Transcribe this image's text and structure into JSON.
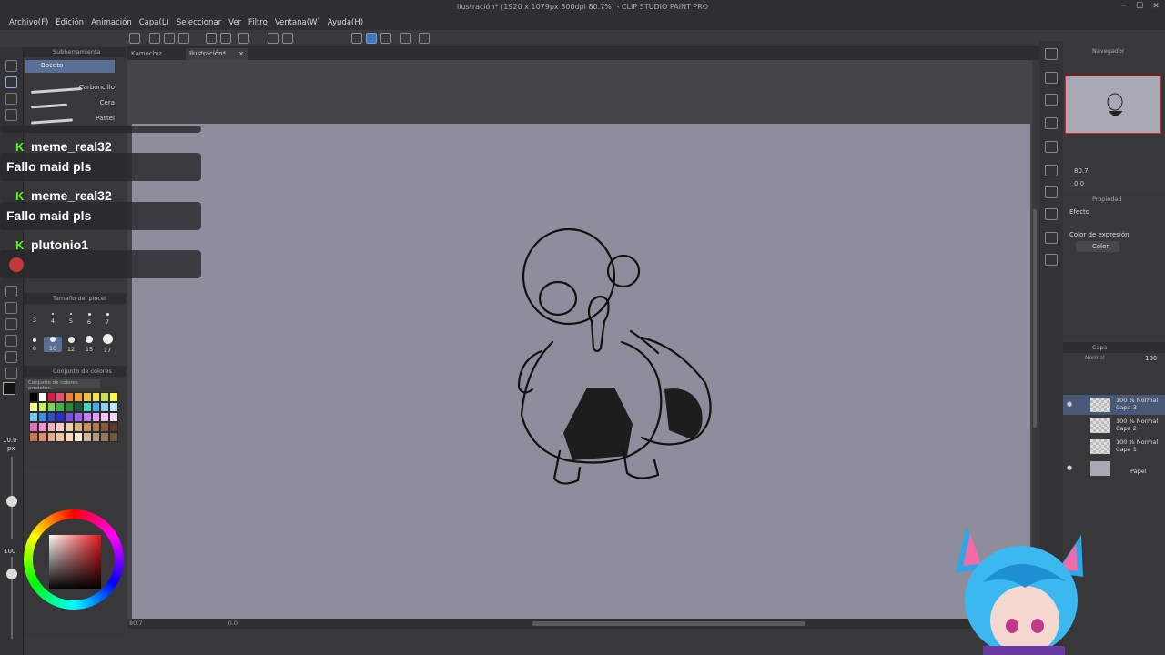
{
  "window": {
    "title": "Ilustración* (1920 x 1079px 300dpi 80.7%) - CLIP STUDIO PAINT PRO",
    "min": "─",
    "max": "☐",
    "close": "✕"
  },
  "menu": [
    "Archivo(F)",
    "Edición",
    "Animación",
    "Capa(L)",
    "Seleccionar",
    "Ver",
    "Filtro",
    "Ventana(W)",
    "Ayuda(H)"
  ],
  "tabs": [
    {
      "label": "Kamochiz"
    },
    {
      "label": "Ilustración*",
      "close": "×"
    }
  ],
  "subtool": {
    "header": "Subherramienta",
    "selected": "Boceto",
    "brushes": [
      "Carboncillo",
      "Cera",
      "Pastel"
    ]
  },
  "brush_size": {
    "header": "Tamaño del pincel",
    "row1": [
      "3",
      "4",
      "5",
      "6",
      "7"
    ],
    "row2": [
      "8",
      "10",
      "12",
      "15",
      "17"
    ],
    "selected": "10"
  },
  "left_size": {
    "value": "10.0",
    "unit": "px",
    "opacity": "100"
  },
  "color_set": {
    "header": "Conjunto de colores",
    "selector": "Conjunto de colores predeter...",
    "colors": [
      "#000000",
      "#ffffff",
      "#e8143c",
      "#ef4b79",
      "#f07d3b",
      "#f0a030",
      "#f0c040",
      "#f5e04a",
      "#c8e04a",
      "#fbfb40",
      "#f8f888",
      "#c8f05a",
      "#7ad25a",
      "#3cb44a",
      "#2a8a3a",
      "#1a5a3a",
      "#40d8c0",
      "#40b0f0",
      "#8ad0f0",
      "#c0e8f8",
      "#6ec8f0",
      "#3a90e8",
      "#2850d0",
      "#2a2ad8",
      "#7a50e0",
      "#a060f0",
      "#c080f8",
      "#e0a0f8",
      "#f0c0f0",
      "#f8d8f0",
      "#e070c0",
      "#f090d0",
      "#f0b0c0",
      "#f8c8c8",
      "#e8d0b0",
      "#d8b080",
      "#c09060",
      "#a87848",
      "#8a5a38",
      "#5a3a28",
      "#c87850",
      "#d89070",
      "#e8a888",
      "#f0c0a0",
      "#f8d8c0",
      "#fae8d8",
      "#d0b8a0",
      "#b09880",
      "#907860",
      "#705840"
    ]
  },
  "navigator": {
    "header": "Navegador",
    "zoom": "80.7",
    "rotation": "0.0"
  },
  "properties": {
    "header": "Propiedad",
    "effect": "Efecto",
    "expression_label": "Color de expresión",
    "expression_value": "Color"
  },
  "layers": {
    "header": "Capa",
    "blend": "Normal",
    "opacity": "100",
    "items": [
      {
        "opacity": "100 % Normal",
        "name": "Capa 3",
        "selected": true
      },
      {
        "opacity": "100 % Normal",
        "name": "Capa 2"
      },
      {
        "opacity": "100 % Normal",
        "name": "Capa 1"
      },
      {
        "opacity": "",
        "name": "Papel"
      }
    ]
  },
  "status": {
    "zoom": "80.7",
    "angle": "0.0"
  },
  "chat": [
    {
      "badge": "K",
      "user": "meme_real32",
      "message": "Fallo maid pls"
    },
    {
      "badge": "K",
      "user": "meme_real32",
      "message": "Fallo maid pls"
    },
    {
      "badge": "K",
      "user": "plutonio1",
      "message": ""
    }
  ],
  "icons": [
    "pen-icon",
    "pencil-icon",
    "brush-icon",
    "eraser-icon",
    "text-icon",
    "lasso-icon",
    "hand-icon",
    "eyedropper-icon",
    "zoom-icon",
    "undo-icon",
    "redo-icon"
  ]
}
